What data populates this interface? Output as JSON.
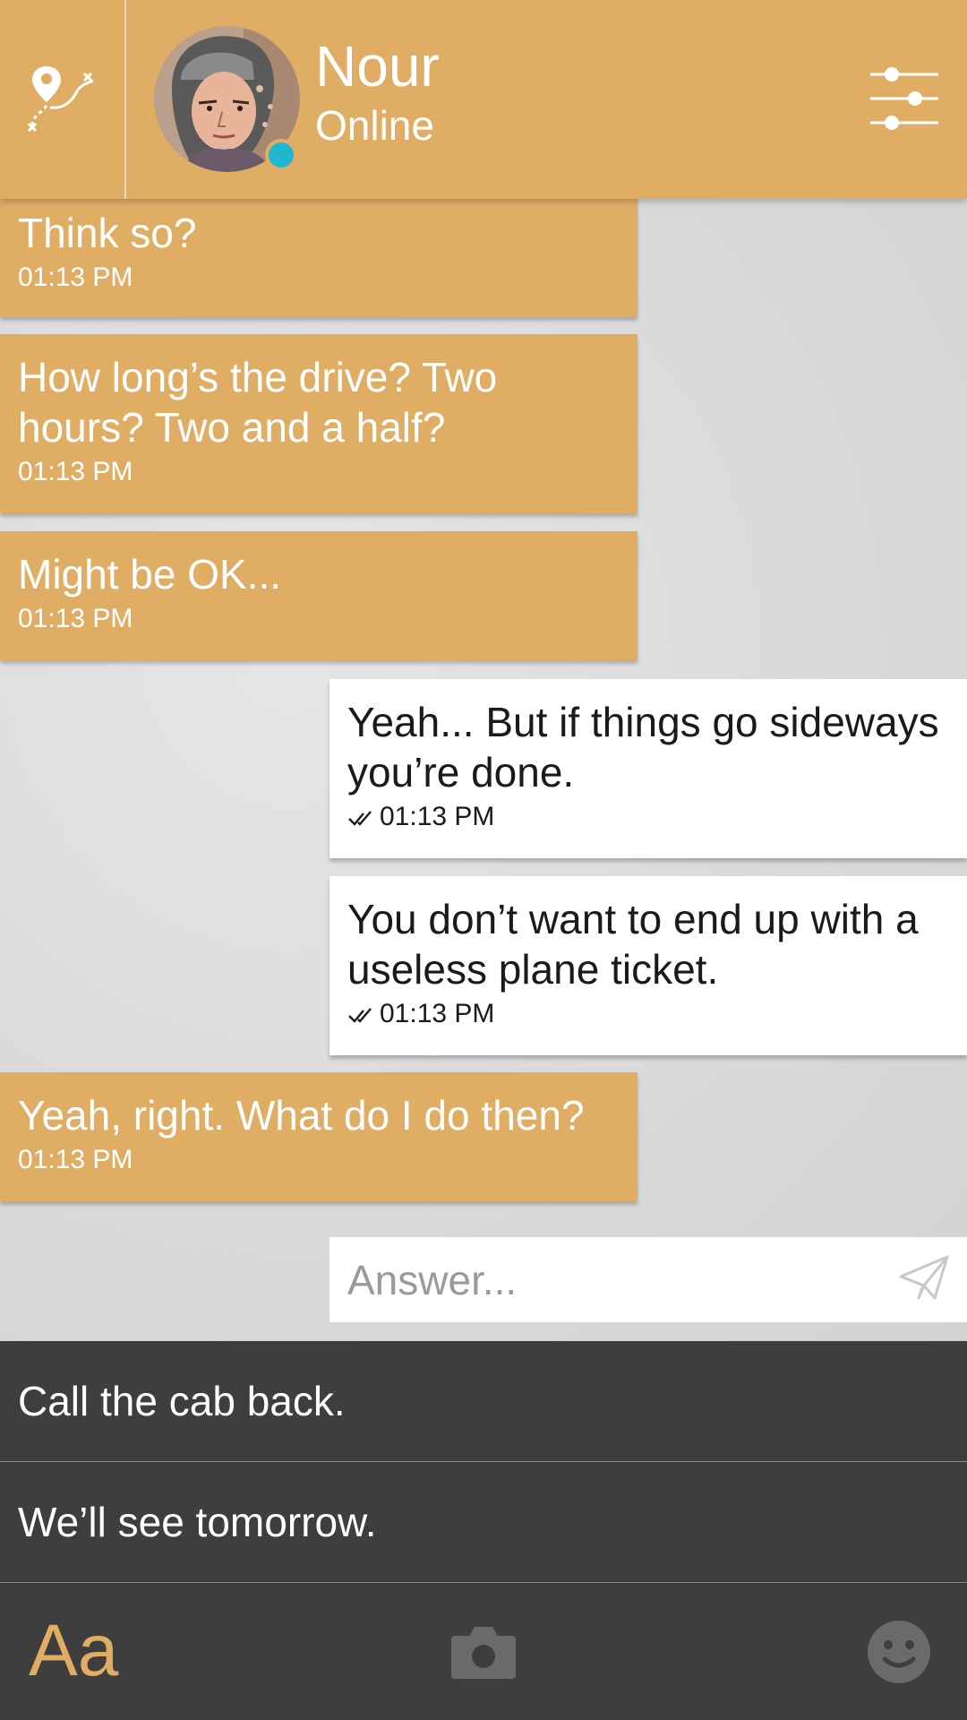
{
  "header": {
    "contact_name": "Nour",
    "contact_status": "Online",
    "status_color": "#1fb8d0",
    "map_icon": "map-route-icon",
    "settings_icon": "sliders-icon",
    "accent": "#e0ad65"
  },
  "messages": [
    {
      "direction": "in",
      "text": "Think so?",
      "time": "01:13 PM"
    },
    {
      "direction": "in",
      "text": "How long’s the drive? Two hours? Two and a half?",
      "time": "01:13 PM"
    },
    {
      "direction": "in",
      "text": "Might be OK...",
      "time": "01:13 PM"
    },
    {
      "direction": "out",
      "text": "Yeah... But if things go sideways you’re done.",
      "time": "01:13 PM",
      "read": true
    },
    {
      "direction": "out",
      "text": "You don’t want to end up with a useless plane ticket.",
      "time": "01:13 PM",
      "read": true
    },
    {
      "direction": "in",
      "text": "Yeah, right. What do I do then?",
      "time": "01:13 PM"
    }
  ],
  "composer": {
    "placeholder": "Answer...",
    "send_icon": "paper-plane-icon"
  },
  "choices": [
    {
      "label": "Call the cab back."
    },
    {
      "label": "We’ll see tomorrow."
    }
  ],
  "bottom_bar": {
    "font_label": "Aa",
    "camera_icon": "camera-icon",
    "emoji_icon": "smiley-icon"
  }
}
